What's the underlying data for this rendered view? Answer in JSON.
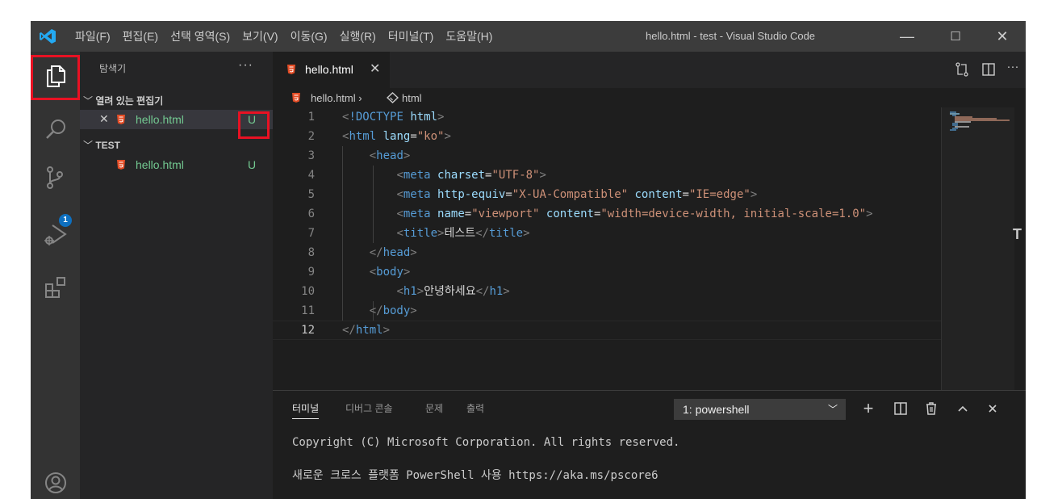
{
  "titlebar": {
    "menu": [
      "파일(F)",
      "편집(E)",
      "선택 영역(S)",
      "보기(V)",
      "이동(G)",
      "실행(R)",
      "터미널(T)",
      "도움말(H)"
    ],
    "window_title": "hello.html - test - Visual Studio Code",
    "minimize": "—",
    "maximize": "☐",
    "close": "✕"
  },
  "activity": {
    "icons": [
      "explorer-icon",
      "search-icon",
      "source-control-icon",
      "run-debug-icon",
      "extensions-icon",
      "account-icon"
    ],
    "source_control_badge": "1"
  },
  "sidebar": {
    "title": "탐색기",
    "more": "···",
    "open_editors": {
      "header": "열려 있는 편집기",
      "items": [
        {
          "close": "✕",
          "name": "hello.html",
          "status": "U"
        }
      ]
    },
    "folder": {
      "header": "TEST",
      "items": [
        {
          "name": "hello.html",
          "status": "U"
        }
      ]
    }
  },
  "editor": {
    "tab": {
      "label": "hello.html",
      "close": "✕"
    },
    "breadcrumb": {
      "file": "hello.html",
      "sep": "›",
      "symbol": "html"
    },
    "current_line": 12,
    "lines": [
      {
        "n": "1",
        "t": [
          [
            "br",
            "<"
          ],
          [
            "tg",
            "!DOCTYPE"
          ],
          [
            "tx",
            " "
          ],
          [
            "at",
            "html"
          ],
          [
            "br",
            ">"
          ]
        ]
      },
      {
        "n": "2",
        "t": [
          [
            "br",
            "<"
          ],
          [
            "tg",
            "html"
          ],
          [
            "tx",
            " "
          ],
          [
            "at",
            "lang"
          ],
          [
            "tx",
            "="
          ],
          [
            "st",
            "\"ko\""
          ],
          [
            "br",
            ">"
          ]
        ]
      },
      {
        "n": "3",
        "t": [
          [
            "tx",
            "    "
          ],
          [
            "br",
            "<"
          ],
          [
            "tg",
            "head"
          ],
          [
            "br",
            ">"
          ]
        ]
      },
      {
        "n": "4",
        "t": [
          [
            "tx",
            "        "
          ],
          [
            "br",
            "<"
          ],
          [
            "tg",
            "meta"
          ],
          [
            "tx",
            " "
          ],
          [
            "at",
            "charset"
          ],
          [
            "tx",
            "="
          ],
          [
            "st",
            "\"UTF-8\""
          ],
          [
            "br",
            ">"
          ]
        ]
      },
      {
        "n": "5",
        "t": [
          [
            "tx",
            "        "
          ],
          [
            "br",
            "<"
          ],
          [
            "tg",
            "meta"
          ],
          [
            "tx",
            " "
          ],
          [
            "at",
            "http-equiv"
          ],
          [
            "tx",
            "="
          ],
          [
            "st",
            "\"X-UA-Compatible\""
          ],
          [
            "tx",
            " "
          ],
          [
            "at",
            "content"
          ],
          [
            "tx",
            "="
          ],
          [
            "st",
            "\"IE=edge\""
          ],
          [
            "br",
            ">"
          ]
        ]
      },
      {
        "n": "6",
        "t": [
          [
            "tx",
            "        "
          ],
          [
            "br",
            "<"
          ],
          [
            "tg",
            "meta"
          ],
          [
            "tx",
            " "
          ],
          [
            "at",
            "name"
          ],
          [
            "tx",
            "="
          ],
          [
            "st",
            "\"viewport\""
          ],
          [
            "tx",
            " "
          ],
          [
            "at",
            "content"
          ],
          [
            "tx",
            "="
          ],
          [
            "st",
            "\"width=device-width, initial-scale=1.0\""
          ],
          [
            "br",
            ">"
          ]
        ]
      },
      {
        "n": "7",
        "t": [
          [
            "tx",
            "        "
          ],
          [
            "br",
            "<"
          ],
          [
            "tg",
            "title"
          ],
          [
            "br",
            ">"
          ],
          [
            "tx",
            "테스트"
          ],
          [
            "br",
            "</"
          ],
          [
            "tg",
            "title"
          ],
          [
            "br",
            ">"
          ]
        ]
      },
      {
        "n": "8",
        "t": [
          [
            "tx",
            "    "
          ],
          [
            "br",
            "</"
          ],
          [
            "tg",
            "head"
          ],
          [
            "br",
            ">"
          ]
        ]
      },
      {
        "n": "9",
        "t": [
          [
            "tx",
            "    "
          ],
          [
            "br",
            "<"
          ],
          [
            "tg",
            "body"
          ],
          [
            "br",
            ">"
          ]
        ]
      },
      {
        "n": "10",
        "t": [
          [
            "tx",
            "        "
          ],
          [
            "br",
            "<"
          ],
          [
            "tg",
            "h1"
          ],
          [
            "br",
            ">"
          ],
          [
            "tx",
            "안녕하세요"
          ],
          [
            "br",
            "</"
          ],
          [
            "tg",
            "h1"
          ],
          [
            "br",
            ">"
          ]
        ]
      },
      {
        "n": "11",
        "t": [
          [
            "tx",
            "    "
          ],
          [
            "br",
            "</"
          ],
          [
            "tg",
            "body"
          ],
          [
            "br",
            ">"
          ]
        ]
      },
      {
        "n": "12",
        "t": [
          [
            "br",
            "</"
          ],
          [
            "tg",
            "html"
          ],
          [
            "br",
            ">"
          ]
        ]
      }
    ]
  },
  "panel": {
    "tabs": [
      "터미널",
      "디버그 콘솔",
      "문제",
      "출력"
    ],
    "terminal_select": "1: powershell",
    "icons": [
      "add-terminal-icon",
      "split-terminal-icon",
      "trash-icon",
      "maximize-panel-icon",
      "close-panel-icon"
    ],
    "terminal_lines": [
      "Copyright (C) Microsoft Corporation. All rights reserved.",
      "새로운 크로스 플랫폼 PowerShell 사용 https://aka.ms/pscore6"
    ]
  },
  "colors": {
    "accent_red": "#e81123",
    "untracked_green": "#73c991",
    "badge_blue": "#0e70c0",
    "html_orange": "#e44d26"
  }
}
